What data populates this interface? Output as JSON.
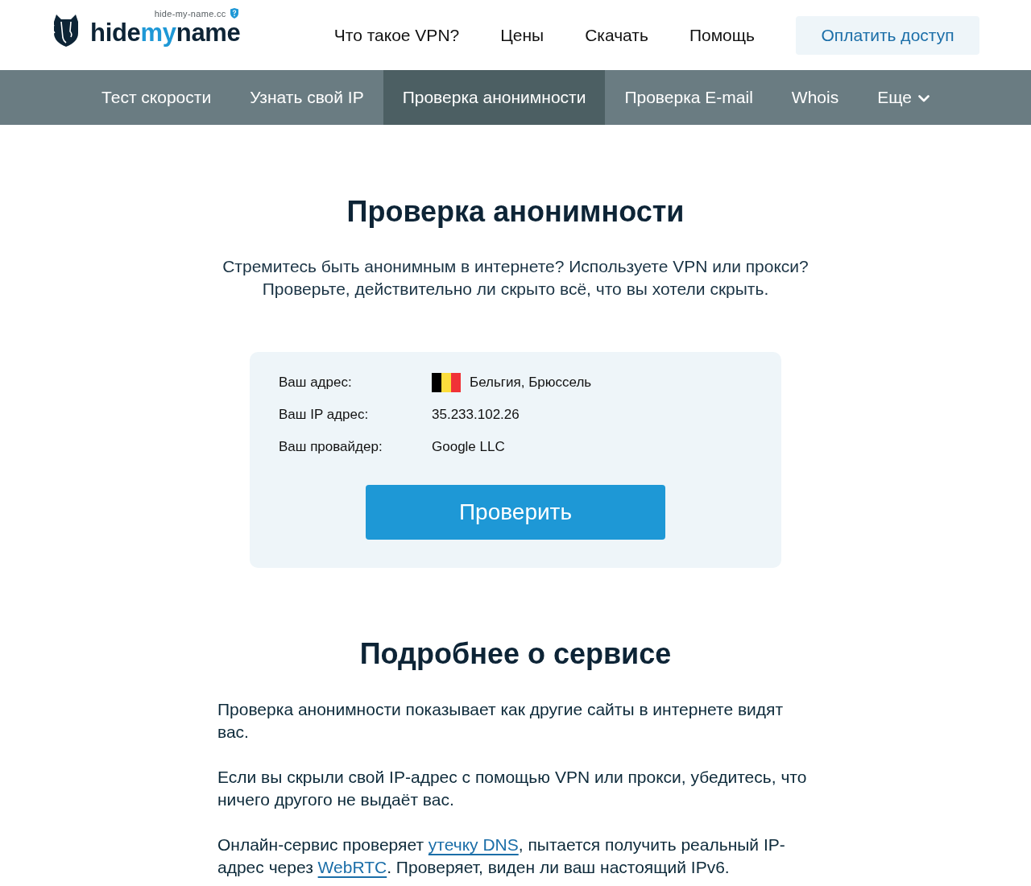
{
  "header": {
    "domain": "hide-my-name.cc",
    "logo": {
      "parts": [
        {
          "text": "hide",
          "accent": false
        },
        {
          "text": "my",
          "accent": true
        },
        {
          "text": "name",
          "accent": false
        }
      ]
    },
    "nav": [
      {
        "label": "Что такое VPN?"
      },
      {
        "label": "Цены"
      },
      {
        "label": "Скачать"
      },
      {
        "label": "Помощь"
      }
    ],
    "cta": "Оплатить доступ"
  },
  "tools_nav": [
    {
      "label": "Тест скорости",
      "selected": false,
      "kind": "link"
    },
    {
      "label": "Узнать свой IP",
      "selected": false,
      "kind": "link"
    },
    {
      "label": "Проверка анонимности",
      "selected": true,
      "kind": "link"
    },
    {
      "label": "Проверка E-mail",
      "selected": false,
      "kind": "link"
    },
    {
      "label": "Whois",
      "selected": false,
      "kind": "link"
    },
    {
      "label": "Еще",
      "selected": false,
      "kind": "dropdown"
    }
  ],
  "hero": {
    "title": "Проверка анонимности",
    "subtitle": [
      "Стремитесь быть анонимным в интернете? Используете VPN или прокси?",
      "Проверьте, действительно ли скрыто всё, что вы хотели скрыть."
    ]
  },
  "check_card": {
    "rows": [
      {
        "label": "Ваш адрес:",
        "value": "Бельгия, Брюссель",
        "kind": "location"
      },
      {
        "label": "Ваш IP адрес:",
        "value": "35.233.102.26",
        "kind": "text"
      },
      {
        "label": "Ваш провайдер:",
        "value": "Google LLC",
        "kind": "text"
      }
    ],
    "button": "Проверить"
  },
  "about": {
    "title": "Подробнее о сервисе",
    "paragraphs": [
      [
        {
          "text": "Проверка анонимности показывает как другие сайты в интернете видят вас.",
          "link": false
        }
      ],
      [
        {
          "text": "Если вы скрыли свой IP-адрес с помощью VPN или прокси, убедитесь, что ничего другого не выдаёт вас.",
          "link": false
        }
      ],
      [
        {
          "text": "Онлайн-сервис проверяет ",
          "link": false
        },
        {
          "text": "утечку DNS",
          "link": true
        },
        {
          "text": ", пытается получить реальный IP-адрес через ",
          "link": false
        },
        {
          "text": "WebRTC",
          "link": true
        },
        {
          "text": ". Проверяет, виден ли ваш настоящий IPv6.",
          "link": false
        }
      ]
    ]
  }
}
